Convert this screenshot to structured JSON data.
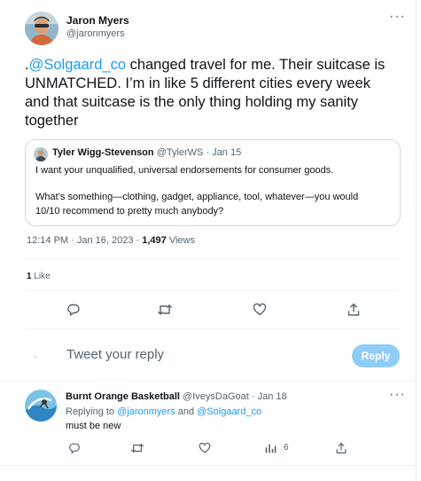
{
  "tweet": {
    "author_name": "Jaron Myers",
    "author_handle": "@jaronmyers",
    "text_prefix": ".",
    "text_mention": "@Solgaard_co",
    "text_body": " changed travel for me. Their suitcase is UNMATCHED. I’m in like 5 different cities every week and that suitcase is the only thing holding my sanity together",
    "timestamp": "12:14 PM · Jan 16, 2023 · ",
    "views_count": "1,497",
    "views_label": " Views",
    "likes_count": "1",
    "likes_label": " Like"
  },
  "quote": {
    "author_name": "Tyler Wigg-Stevenson",
    "author_handle": "@TylerWS",
    "date": "· Jan 15",
    "line1": "I want your unqualified, universal endorsements for consumer goods.",
    "line2": "What’s something—clothing, gadget, appliance, tool, whatever—you would",
    "line3": "10/10 recommend to pretty much anybody?"
  },
  "composer": {
    "placeholder": "Tweet your reply",
    "reply_label": "Reply"
  },
  "reply": {
    "author_name": "Burnt Orange Basketball",
    "author_handle": "@IveysDaGoat",
    "date": "· Jan 18",
    "replying_prefix": "Replying to ",
    "mention1": "@jaronmyers",
    "and_text": " and ",
    "mention2": "@Solgaard_co",
    "text": "must be new",
    "views_count": "6"
  },
  "icons": {
    "reply": "reply-icon",
    "retweet": "retweet-icon",
    "like": "heart-icon",
    "share": "share-icon",
    "views": "views-icon",
    "more": "more-icon"
  },
  "colors": {
    "link": "#1d9bf0",
    "reply_button": "#8ecdf8",
    "muted": "#536471"
  }
}
